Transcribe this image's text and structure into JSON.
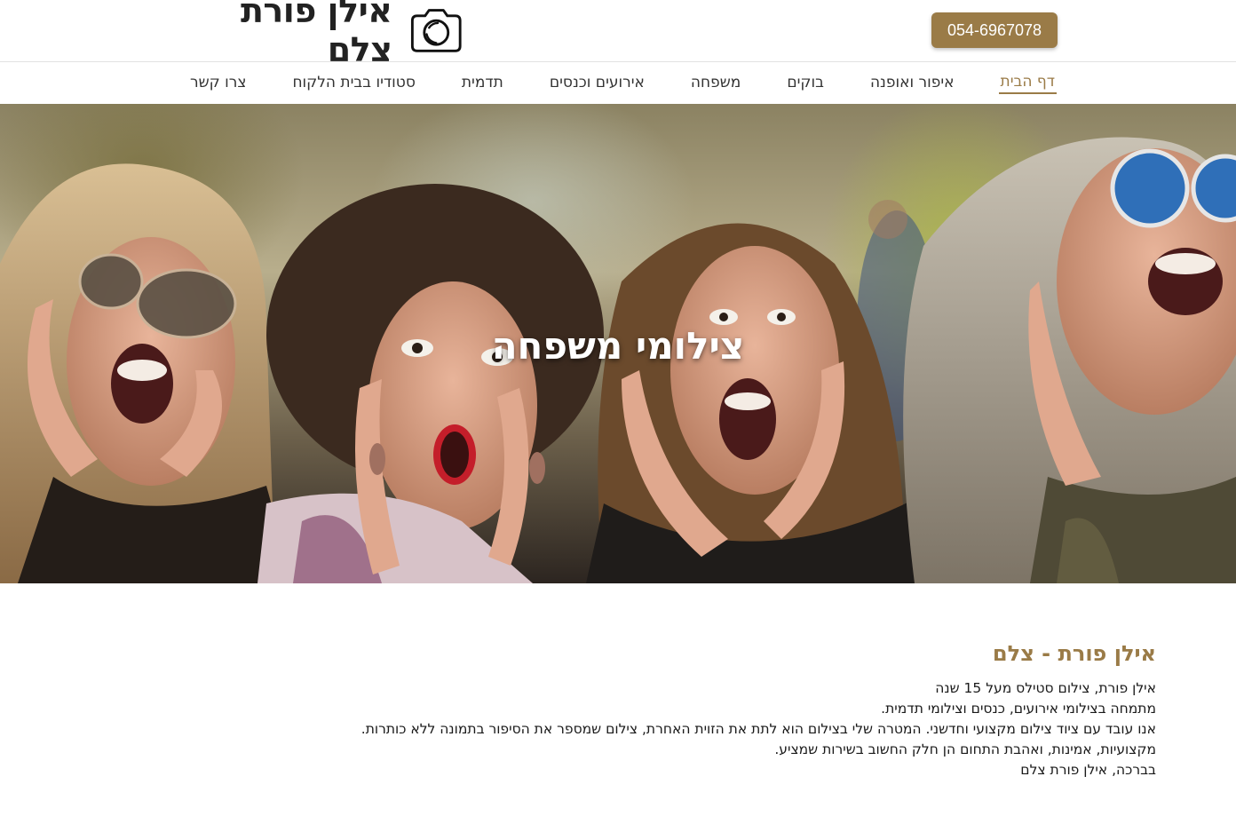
{
  "header": {
    "logo_text": "אילן פורת צלם",
    "phone": "054-6967078"
  },
  "nav": {
    "items": [
      {
        "label": "דף הבית",
        "active": true
      },
      {
        "label": "איפור ואופנה"
      },
      {
        "label": "בוקים"
      },
      {
        "label": "משפחה"
      },
      {
        "label": "אירועים וכנסים"
      },
      {
        "label": "תדמית"
      },
      {
        "label": "סטודיו בבית הלקוח"
      },
      {
        "label": "צרו קשר"
      }
    ]
  },
  "hero": {
    "title": "צילומי משפחה"
  },
  "content": {
    "title": "אילן פורת - צלם",
    "lines": [
      "אילן פורת, צילום סטילס מעל 15 שנה",
      "מתמחה בצילומי אירועים, כנסים וצילומי תדמית.",
      "אנו עובד עם ציוד צילום מקצועי וחדשני. המטרה שלי בצילום הוא לתת את הזוית האחרת, צילום שמספר את הסיפור בתמונה ללא כותרות.",
      "מקצועיות, אמינות, ואהבת התחום הן חלק החשוב בשירות שמציע.",
      "בברכה, אילן פורת צלם"
    ]
  },
  "colors": {
    "accent": "#9a7b47",
    "text": "#1a1a1a",
    "nav_text": "#333333"
  },
  "icons": {
    "logo": "camera-icon"
  }
}
